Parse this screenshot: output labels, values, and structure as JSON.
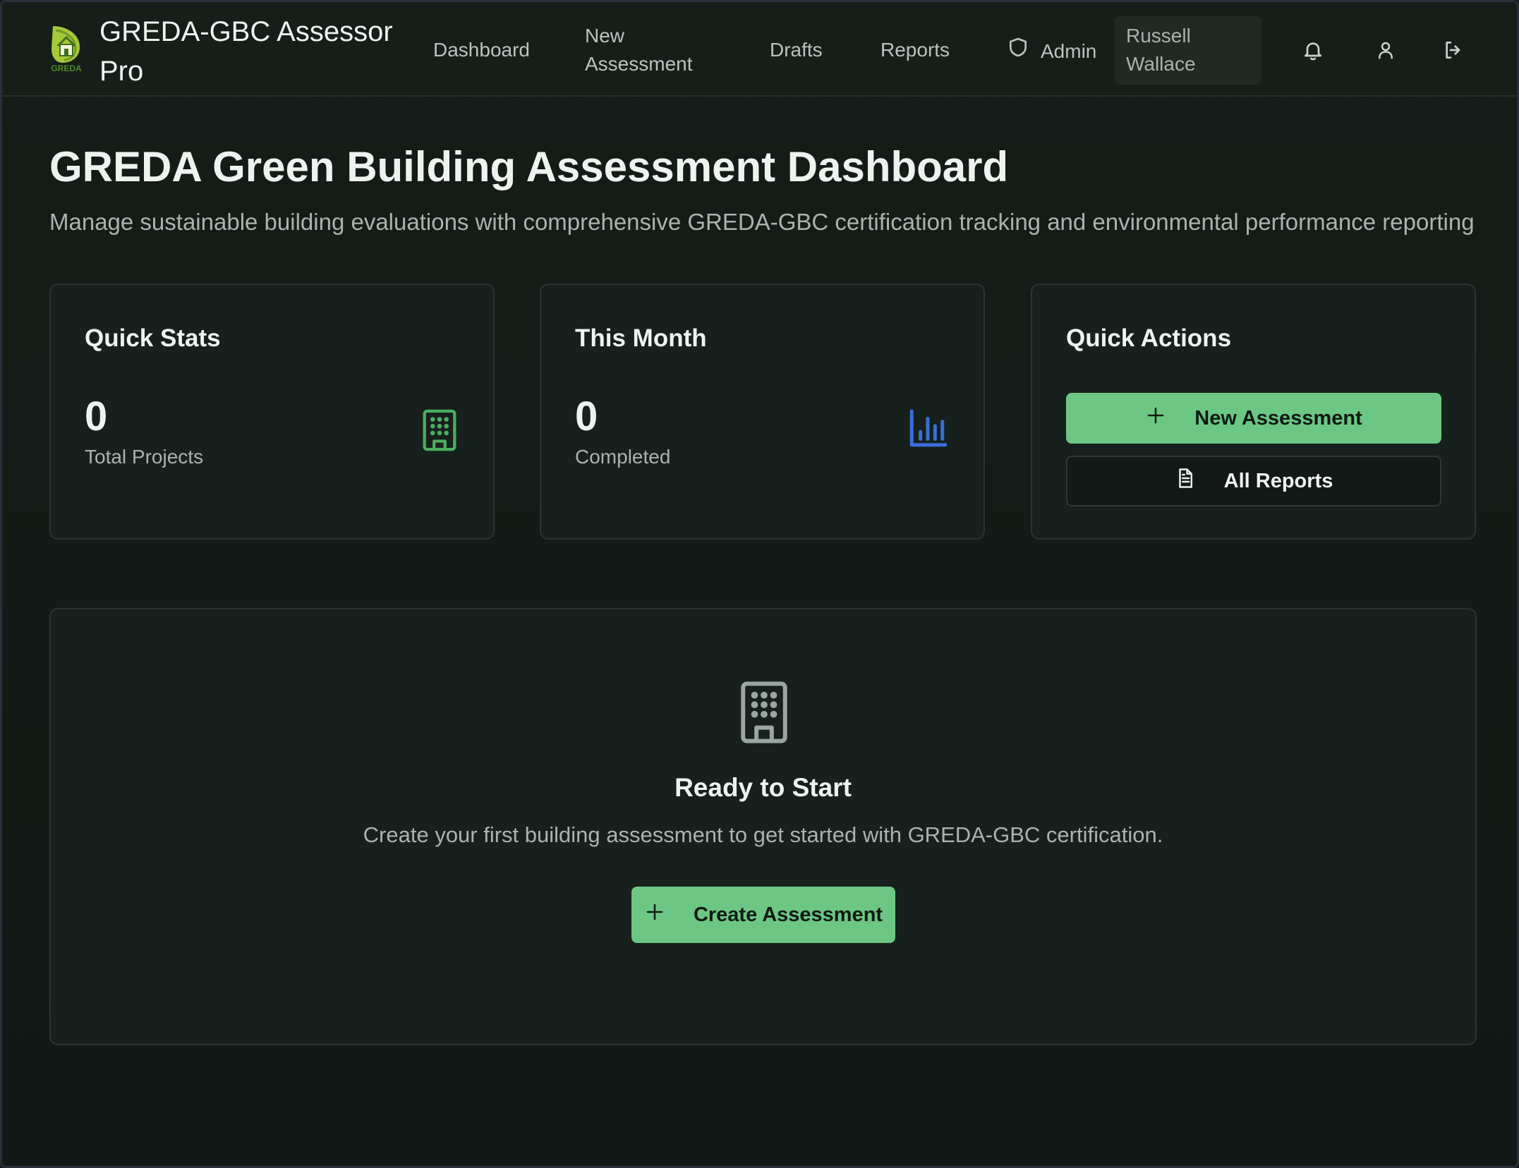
{
  "header": {
    "brand": "GREDA-GBC Assessor Pro",
    "logo_text": "GREDA",
    "nav": {
      "dashboard": "Dashboard",
      "new_assessment": "New Assessment",
      "drafts": "Drafts",
      "reports": "Reports",
      "admin": "Admin"
    },
    "user_name": "Russell Wallace",
    "icons": [
      "shield-icon",
      "bell-icon",
      "user-icon",
      "logout-icon"
    ]
  },
  "page": {
    "title": "GREDA Green Building Assessment Dashboard",
    "subtitle": "Manage sustainable building evaluations with comprehensive GREDA-GBC certification tracking and environmental performance reporting"
  },
  "cards": {
    "quick_stats": {
      "title": "Quick Stats",
      "value": "0",
      "label": "Total Projects",
      "icon": "building-icon",
      "icon_color": "#4caf5f"
    },
    "this_month": {
      "title": "This Month",
      "value": "0",
      "label": "Completed",
      "icon": "bar-chart-icon",
      "icon_color": "#3b6fd9"
    },
    "quick_actions": {
      "title": "Quick Actions",
      "new_assessment_label": "New Assessment",
      "all_reports_label": "All Reports"
    }
  },
  "empty_state": {
    "title": "Ready to Start",
    "text": "Create your first building assessment to get started with GREDA-GBC certification.",
    "button_label": "Create Assessment",
    "icon": "building-icon"
  },
  "colors": {
    "accent": "#6cc784",
    "background": "#131a17",
    "card": "#17201c"
  }
}
